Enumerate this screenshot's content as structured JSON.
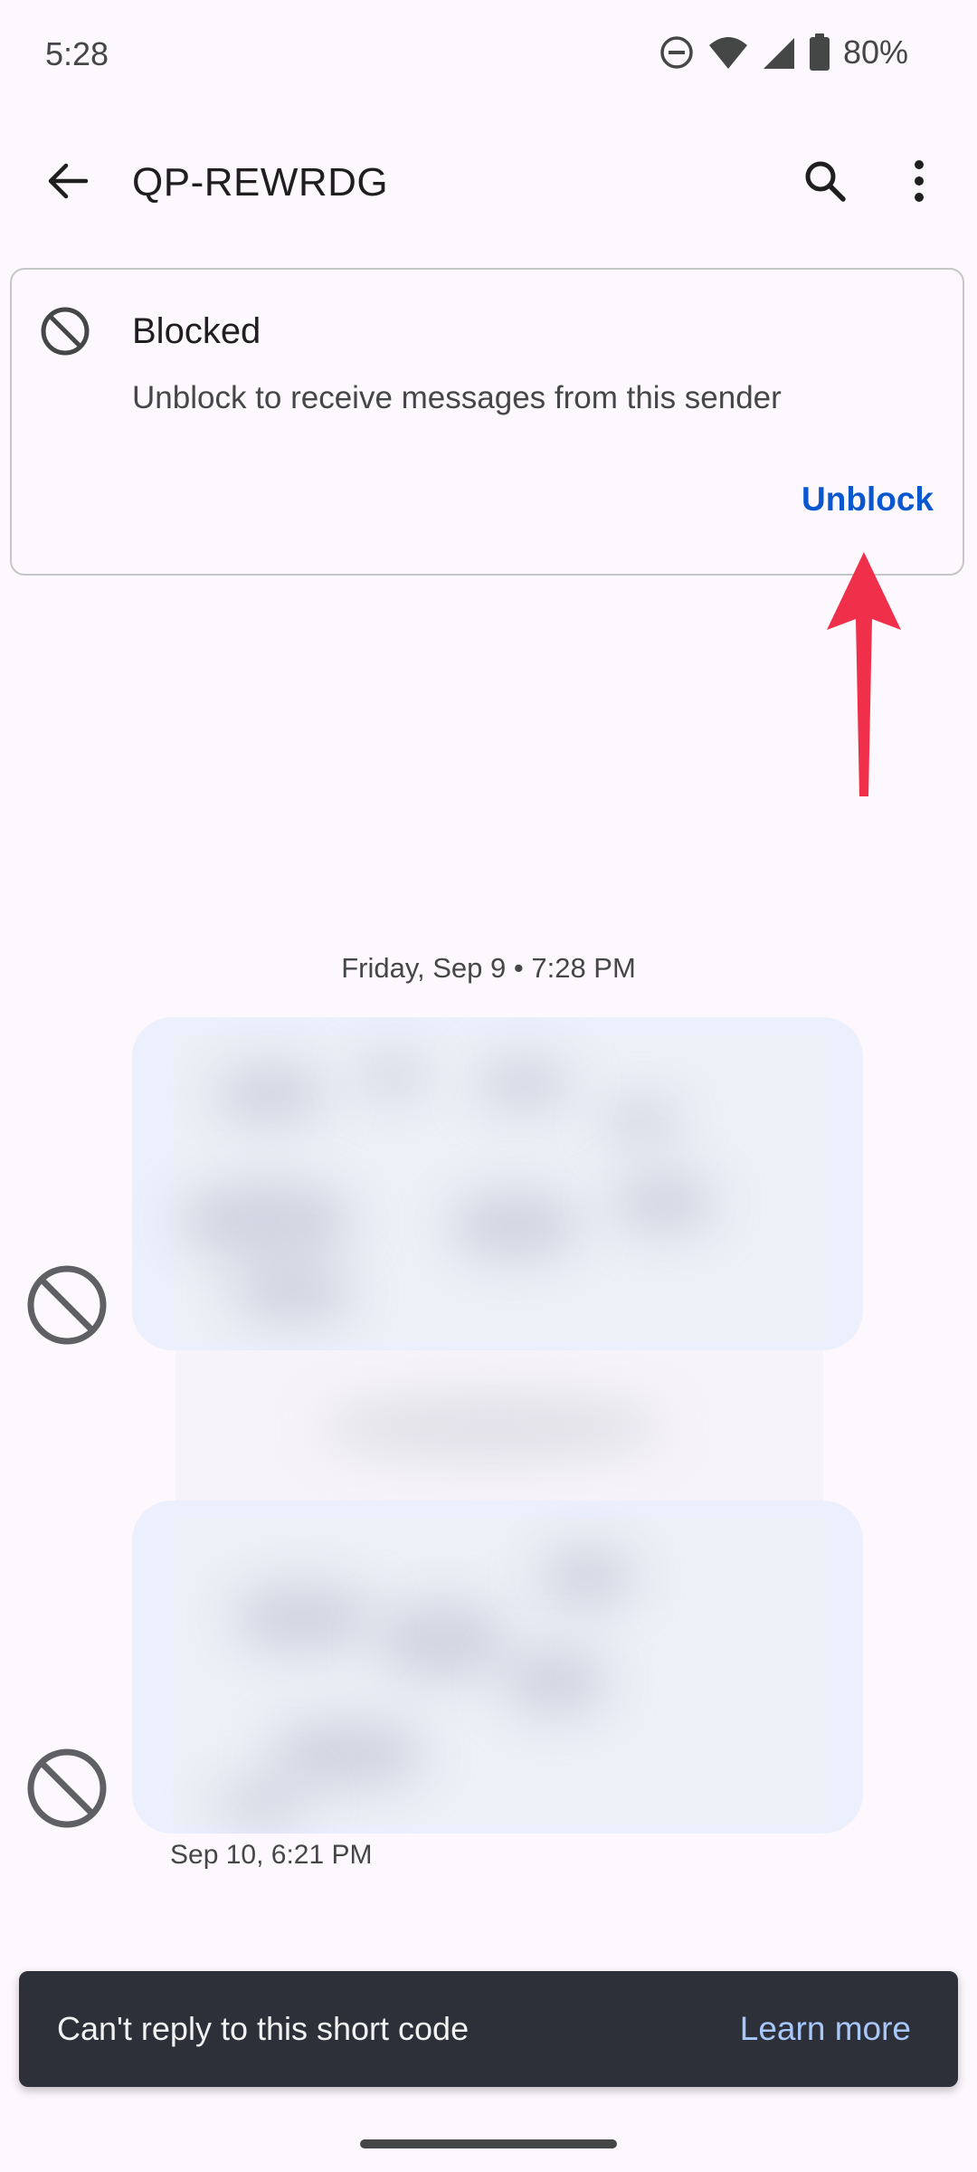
{
  "status_bar": {
    "time": "5:28",
    "battery": "80%",
    "icons": [
      "do-not-disturb-icon",
      "wifi-icon",
      "cell-signal-icon",
      "battery-icon"
    ]
  },
  "app_bar": {
    "title": "QP-REWRDG",
    "icons": [
      "back-arrow-icon",
      "search-icon",
      "more-vert-icon"
    ]
  },
  "blocked_card": {
    "title": "Blocked",
    "description": "Unblock to receive messages from this sender",
    "action_label": "Unblock",
    "icon": "block-icon"
  },
  "conversation": {
    "date_separator": "Friday, Sep 9 • 7:28 PM",
    "messages": [
      {
        "content": "blurred",
        "status_icon": "block-icon"
      },
      {
        "content": "blurred",
        "status_icon": "block-icon",
        "timestamp": "Sep 10, 6:21 PM"
      }
    ]
  },
  "snackbar": {
    "text": "Can't reply to this short code",
    "action_label": "Learn more"
  },
  "colors": {
    "accent": "#0b57d0",
    "bubble": "#ecf0fc",
    "snackbar_bg": "#2d3039",
    "snackbar_action": "#a8c7fa",
    "annotation_arrow": "#f0304a"
  }
}
